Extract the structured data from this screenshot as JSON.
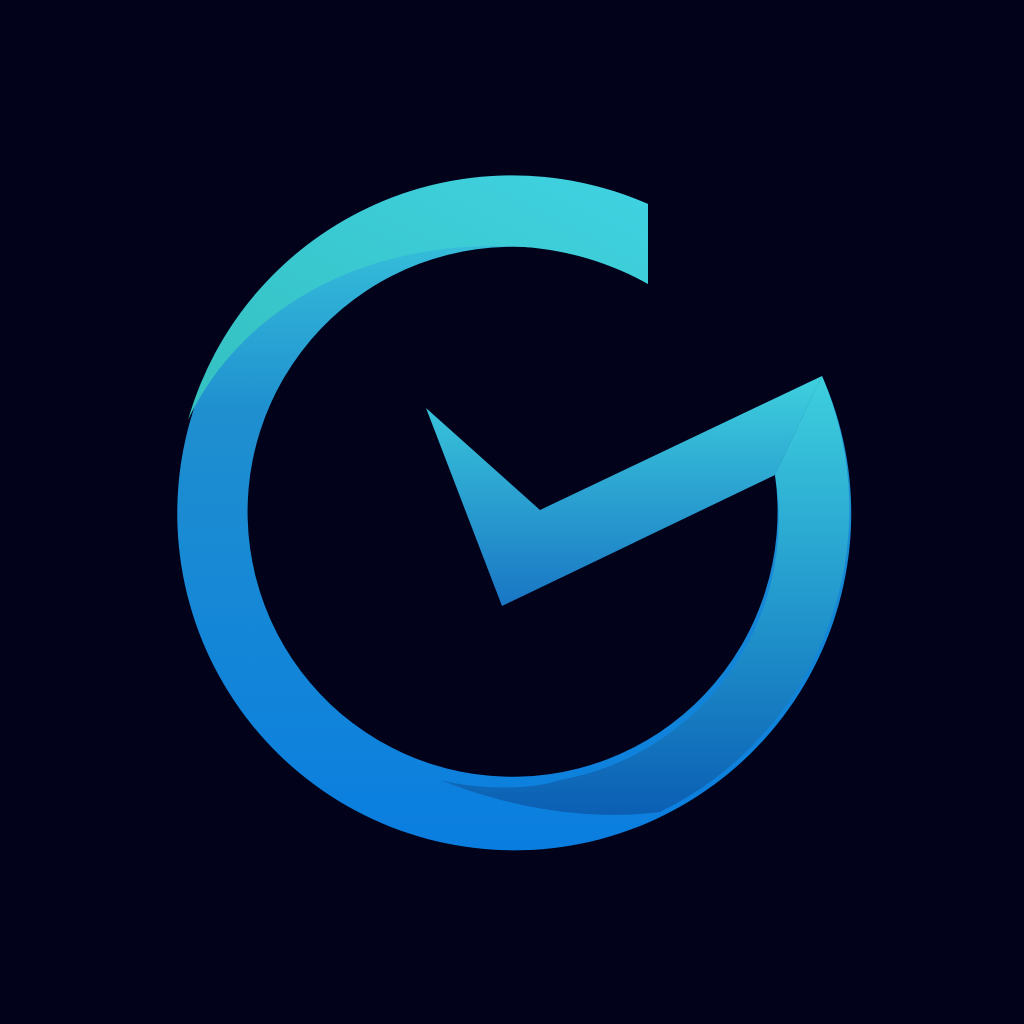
{
  "logo": {
    "name": "clock-g-logo",
    "icon": "clock-g-icon",
    "colors": {
      "background": "#02021a",
      "teal": "#3ed0de",
      "aqua": "#35c0c8",
      "blue": "#0a76d6",
      "deep_blue": "#0b5fb4"
    }
  }
}
